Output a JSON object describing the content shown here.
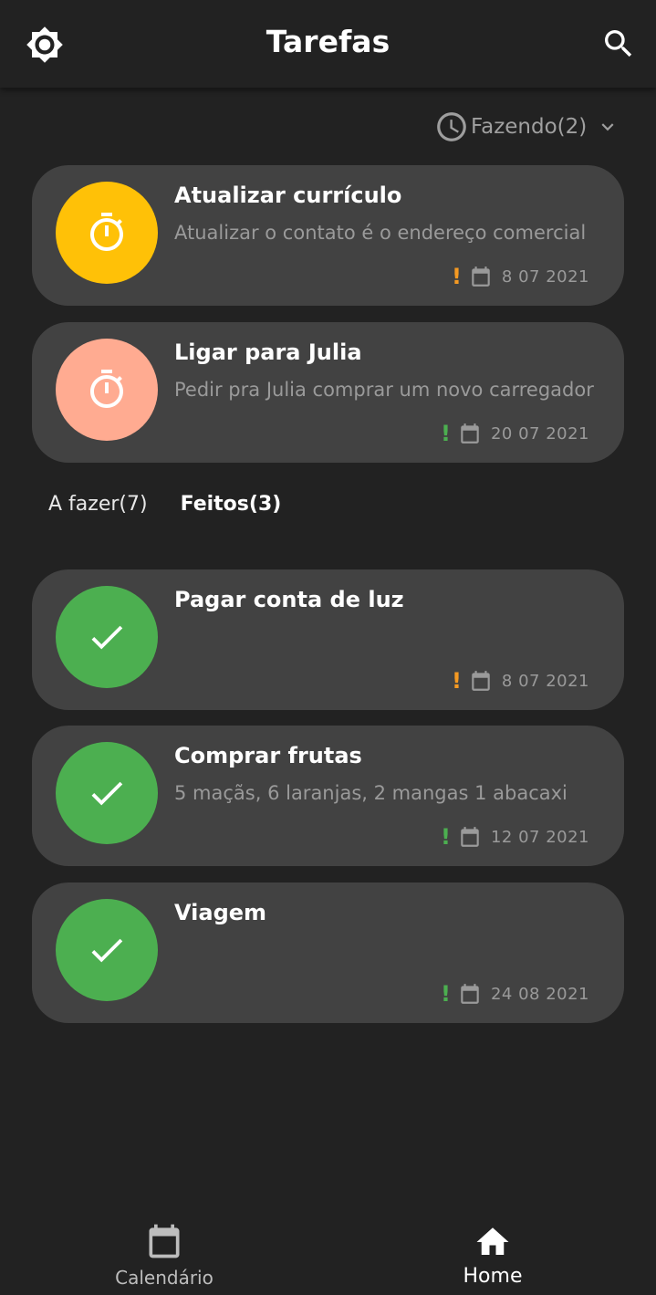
{
  "appbar": {
    "title": "Tarefas",
    "left_icon": "brightness-icon",
    "right_icon": "search-icon"
  },
  "filter": {
    "label": "Fazendo(2)",
    "icon": "clock-icon"
  },
  "doing": [
    {
      "title": "Atualizar currículo",
      "description": "Atualizar o contato é o endereço comercial",
      "date": "8 07 2021",
      "priority_color": "#f59a22",
      "avatar_color": "#ffc107",
      "icon": "timer-icon"
    },
    {
      "title": "Ligar para Julia",
      "description": "Pedir pra Julia comprar um novo carregador",
      "date": "20 07 2021",
      "priority_color": "#4caf50",
      "avatar_color": "#ffab91",
      "icon": "timer-icon"
    }
  ],
  "tabs": {
    "todo": "A fazer(7)",
    "done": "Feitos(3)",
    "active": "done"
  },
  "done": [
    {
      "title": "Pagar conta de luz",
      "description": "",
      "date": "8 07 2021",
      "priority_color": "#f59a22",
      "avatar_color": "#4caf50",
      "icon": "check-icon"
    },
    {
      "title": "Comprar frutas",
      "description": "5 maçãs, 6 laranjas, 2 mangas 1 abacaxi",
      "date": "12 07 2021",
      "priority_color": "#4caf50",
      "avatar_color": "#4caf50",
      "icon": "check-icon"
    },
    {
      "title": "Viagem",
      "description": "",
      "date": "24 08 2021",
      "priority_color": "#4caf50",
      "avatar_color": "#4caf50",
      "icon": "check-icon"
    }
  ],
  "bottom_nav": {
    "calendar": "Calendário",
    "home": "Home",
    "active": "home"
  },
  "colors": {
    "background": "#222222",
    "card": "#424242",
    "text_secondary": "#9a9a9a"
  }
}
